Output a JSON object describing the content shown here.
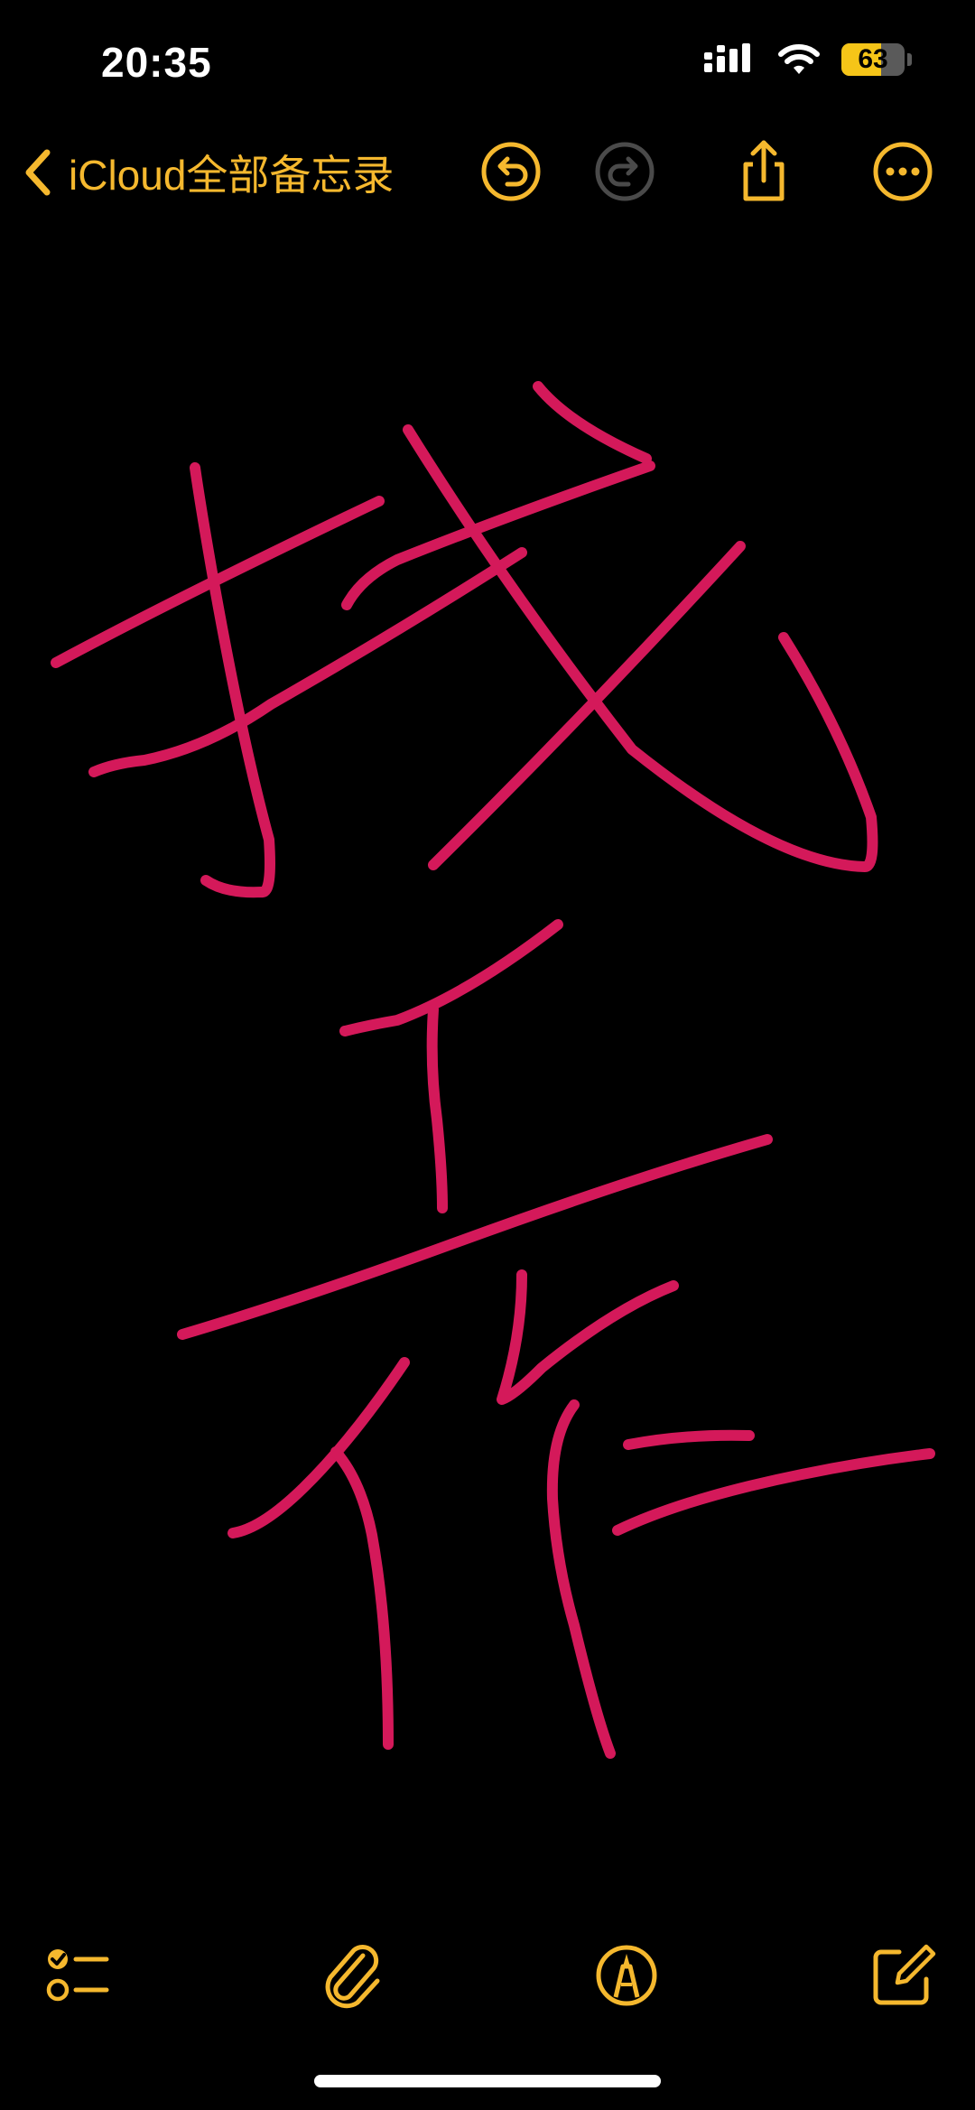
{
  "status_bar": {
    "time": "20:35",
    "battery_percent": "63",
    "battery_level": 0.63
  },
  "nav": {
    "back_label": "iCloud全部备忘录",
    "icons": [
      "undo-icon",
      "redo-icon",
      "share-icon",
      "more-icon"
    ]
  },
  "drawing": {
    "ink_color": "#d4195a",
    "stroke_color_accent": "#f5b82e"
  },
  "toolbar": {
    "icons": [
      "checklist-icon",
      "attachment-icon",
      "markup-icon",
      "compose-icon"
    ]
  },
  "colors": {
    "accent": "#f5b82e",
    "background": "#000000",
    "disabled": "#4a4a4a"
  }
}
